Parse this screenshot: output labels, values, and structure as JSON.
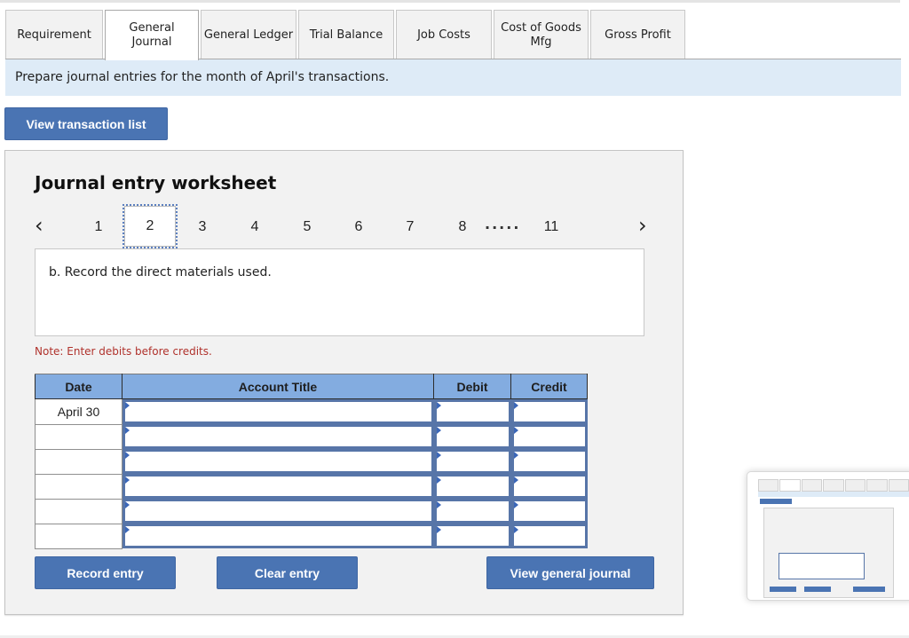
{
  "tabs": [
    {
      "label": "Requirement",
      "active": false
    },
    {
      "label": "General Journal",
      "active": true
    },
    {
      "label": "General Ledger",
      "active": false
    },
    {
      "label": "Trial Balance",
      "active": false
    },
    {
      "label": "Job Costs",
      "active": false
    },
    {
      "label": "Cost of Goods Mfg",
      "active": false
    },
    {
      "label": "Gross Profit",
      "active": false
    }
  ],
  "instruction": "Prepare journal entries for the month of April's transactions.",
  "view_transaction_list_label": "View transaction list",
  "worksheet": {
    "title": "Journal entry worksheet",
    "prev_icon": "chevron-left-icon",
    "next_icon": "chevron-right-icon",
    "pages": [
      "1",
      "2",
      "3",
      "4",
      "5",
      "6",
      "7",
      "8",
      "11"
    ],
    "active_page": "2",
    "ellipsis": ".....",
    "prompt": "b. Record the direct materials used.",
    "note": "Note: Enter debits before credits.",
    "table": {
      "headers": [
        "Date",
        "Account Title",
        "Debit",
        "Credit"
      ],
      "rows": [
        {
          "date": "April 30",
          "account": "",
          "debit": "",
          "credit": ""
        },
        {
          "date": "",
          "account": "",
          "debit": "",
          "credit": ""
        },
        {
          "date": "",
          "account": "",
          "debit": "",
          "credit": ""
        },
        {
          "date": "",
          "account": "",
          "debit": "",
          "credit": ""
        },
        {
          "date": "",
          "account": "",
          "debit": "",
          "credit": ""
        },
        {
          "date": "",
          "account": "",
          "debit": "",
          "credit": ""
        }
      ]
    },
    "buttons": {
      "record": "Record entry",
      "clear": "Clear entry",
      "view_journal": "View general journal"
    }
  },
  "colors": {
    "button_blue": "#4a74b3",
    "header_blue": "#83ace0",
    "banner_blue": "#deebf7",
    "note_red": "#b0322c"
  }
}
